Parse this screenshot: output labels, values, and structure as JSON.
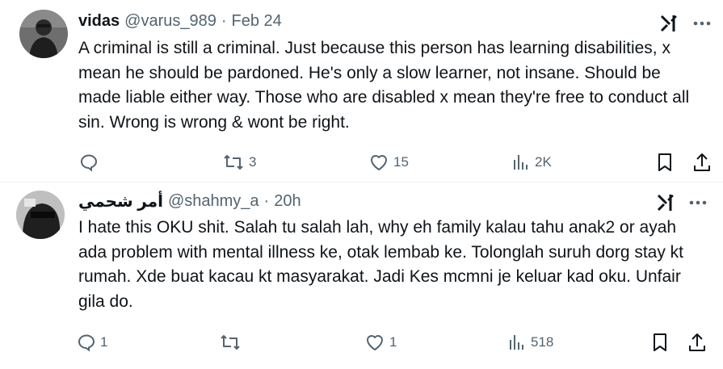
{
  "posts": [
    {
      "display_name": "vidas",
      "handle": "@varus_989",
      "separator": "·",
      "time": "Feb 24",
      "text": "A criminal is still a criminal. Just because this person has learning disabilities, x mean he should be pardoned. He's only a slow learner, not insane. Should be made liable either way. Those who are disabled x mean they're free to conduct all sin. Wrong is wrong & wont be right.",
      "replies": "",
      "reposts": "3",
      "likes": "15",
      "views": "2K"
    },
    {
      "display_name": "أمر شحمي",
      "handle": "@shahmy_a",
      "separator": "·",
      "time": "20h",
      "text": "I hate this OKU shit. Salah tu salah lah, why eh family kalau tahu anak2 or ayah ada problem with mental illness ke, otak lembab ke. Tolonglah suruh dorg stay kt rumah. Xde buat kacau kt masyarakat. Jadi Kes mcmni je keluar kad oku. Unfair gila do.",
      "replies": "1",
      "reposts": "",
      "likes": "1",
      "views": "518"
    }
  ],
  "colors": {
    "text": "#0f1419",
    "secondary": "#536471",
    "divider": "#eff3f4",
    "background": "#ffffff"
  },
  "icons": [
    "grok-icon",
    "more-icon",
    "reply-icon",
    "repost-icon",
    "like-icon",
    "views-icon",
    "bookmark-icon",
    "share-icon"
  ]
}
